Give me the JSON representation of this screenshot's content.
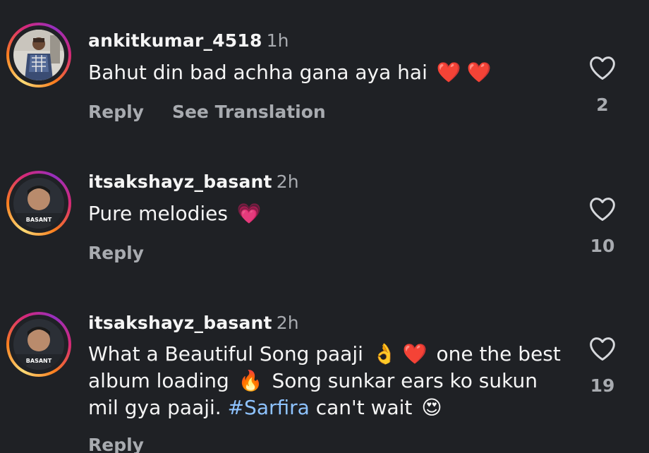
{
  "comments": [
    {
      "username": "ankitkumar_4518",
      "time": "1h",
      "text_parts": [
        "Bahut din bad achha gana aya hai"
      ],
      "emojis": [
        "❤️",
        "❤️"
      ],
      "reply_label": "Reply",
      "translate_label": "See Translation",
      "like_count": "2"
    },
    {
      "username": "itsakshayz_basant",
      "time": "2h",
      "text_parts": [
        "Pure melodies"
      ],
      "emojis": [
        "💗"
      ],
      "reply_label": "Reply",
      "like_count": "10",
      "avatar_label": "BASANT"
    },
    {
      "username": "itsakshayz_basant",
      "time": "2h",
      "text_parts": [
        "What a Beautiful Song paaji",
        "one the best album loading",
        "Song sunkar ears ko sukun mil gya paaji.",
        "#Sarfira",
        "can't wait"
      ],
      "emojis": [
        "👌",
        "❤️",
        "🔥",
        "😍"
      ],
      "reply_label": "Reply",
      "like_count": "19",
      "avatar_label": "BASANT"
    }
  ],
  "colors": {
    "background": "#1f2125",
    "text": "#f5f5f5",
    "muted": "#a8abb0",
    "hashtag": "#8ec3ff"
  },
  "icons": {
    "like": "heart-outline-icon"
  }
}
